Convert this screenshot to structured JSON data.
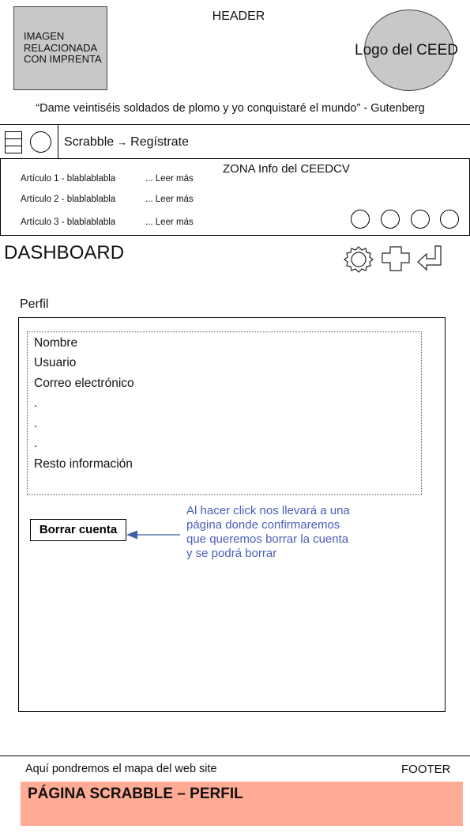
{
  "header": {
    "label": "HEADER",
    "image_placeholder": "IMAGEN\nRELACIONADA\nCON IMPRENTA",
    "logo": "Logo del CEED",
    "quote": "“Dame veintiséis soldados de plomo y yo conquistaré el mundo”  - Gutenberg"
  },
  "nav": {
    "breadcrumb_root": "Scrabble",
    "breadcrumb_separator": "→",
    "breadcrumb_current": "Regístrate"
  },
  "info_zone": {
    "title": "ZONA Info del CEEDCV",
    "articles": [
      {
        "title": "Artículo 1 - blablablabla",
        "link": "... Leer más"
      },
      {
        "title": "Artículo 2 - blablablabla",
        "link": "... Leer más"
      },
      {
        "title": "Artículo 3 - blablablabla",
        "link": "... Leer más"
      }
    ]
  },
  "dashboard": {
    "title": "DASHBOARD",
    "icons": [
      "gear-icon",
      "plus-icon",
      "return-icon"
    ]
  },
  "profile": {
    "label": "Perfil",
    "fields": [
      "Nombre",
      "Usuario",
      "Correo electrónico",
      ".",
      ".",
      ".",
      "Resto información"
    ],
    "delete_button": "Borrar cuenta",
    "annotation": "Al hacer click nos llevará a una página donde confirmaremos que queremos borrar la cuenta y se podrá borrar",
    "annotation_color": "#4a5fb8"
  },
  "footer": {
    "sitemap_text": "Aquí pondremos el mapa del web site",
    "label": "FOOTER",
    "page_title": "PÁGINA SCRABBLE – PERFIL",
    "bar_color": "#ffab95"
  }
}
